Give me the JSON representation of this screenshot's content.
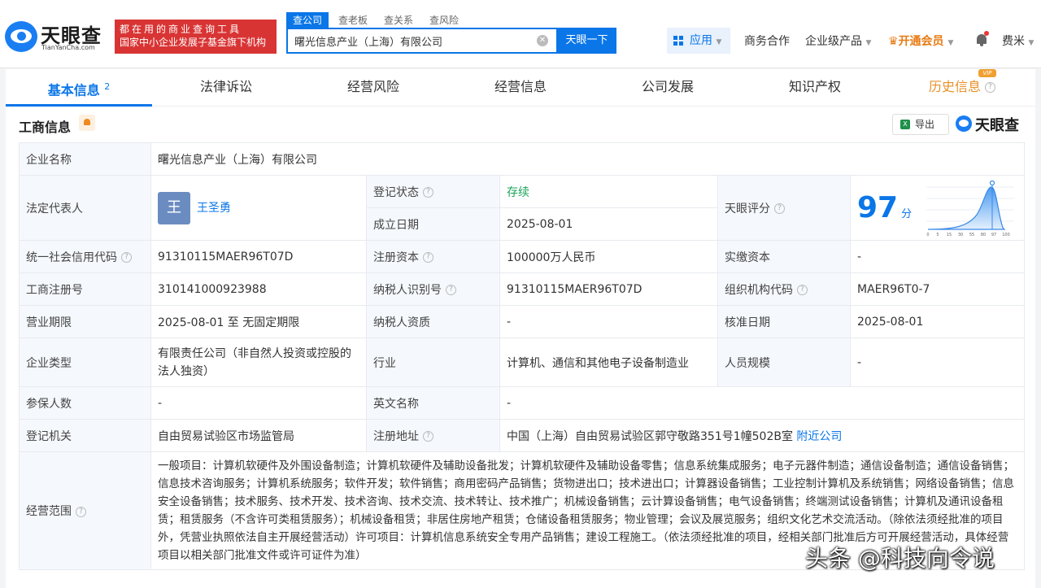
{
  "header": {
    "logo_text": "天眼查",
    "logo_sub": "TianYanCha.com",
    "slogan_line1": "都在用的商业查询工具",
    "slogan_line2": "国家中小企业发展子基金旗下机构",
    "search_tabs": [
      "查公司",
      "查老板",
      "查关系",
      "查风险"
    ],
    "search_value": "曙光信息产业（上海）有限公司",
    "search_button": "天眼一下",
    "app_label": "应用",
    "nav": {
      "business": "商务合作",
      "enterprise": "企业级产品",
      "vip": "开通会员",
      "user": "费米"
    }
  },
  "tabs": [
    {
      "label": "基本信息",
      "count": "2"
    },
    {
      "label": "法律诉讼"
    },
    {
      "label": "经营风险"
    },
    {
      "label": "经营信息"
    },
    {
      "label": "公司发展"
    },
    {
      "label": "知识产权"
    },
    {
      "label": "历史信息",
      "tag": "VIP"
    }
  ],
  "section": {
    "title": "工商信息",
    "export": "导出",
    "export_icon": "xls-icon",
    "brand": "天眼查"
  },
  "info": {
    "company_name_label": "企业名称",
    "company_name": "曙光信息产业（上海）有限公司",
    "legal_rep_label": "法定代表人",
    "legal_rep_avatar": "王",
    "legal_rep": "王圣勇",
    "reg_status_label": "登记状态",
    "reg_status": "存续",
    "found_date_label": "成立日期",
    "found_date": "2025-08-01",
    "score_label": "天眼评分",
    "score": "97",
    "score_unit": "分",
    "score_axis": [
      "0",
      "5",
      "15",
      "30",
      "55",
      "80",
      "97",
      "100"
    ],
    "credit_code_label": "统一社会信用代码",
    "credit_code": "91310115MAER96T07D",
    "reg_capital_label": "注册资本",
    "reg_capital": "100000万人民币",
    "paid_capital_label": "实缴资本",
    "paid_capital": "-",
    "reg_no_label": "工商注册号",
    "reg_no": "310141000923988",
    "taxpayer_id_label": "纳税人识别号",
    "taxpayer_id": "91310115MAER96T07D",
    "org_code_label": "组织机构代码",
    "org_code": "MAER96T0-7",
    "term_label": "营业期限",
    "term": "2025-08-01 至 无固定期限",
    "taxpayer_qual_label": "纳税人资质",
    "taxpayer_qual": "-",
    "approve_date_label": "核准日期",
    "approve_date": "2025-08-01",
    "type_label": "企业类型",
    "type": "有限责任公司（非自然人投资或控股的法人独资）",
    "industry_label": "行业",
    "industry": "计算机、通信和其他电子设备制造业",
    "staff_label": "人员规模",
    "staff": "-",
    "insured_label": "参保人数",
    "insured": "-",
    "en_name_label": "英文名称",
    "en_name": "-",
    "authority_label": "登记机关",
    "authority": "自由贸易试验区市场监管局",
    "address_label": "注册地址",
    "address": "中国（上海）自由贸易试验区郭守敬路351号1幢502B室",
    "nearby": "附近公司",
    "scope_label": "经营范围",
    "scope": "一般项目：计算机软硬件及外围设备制造；计算机软硬件及辅助设备批发；计算机软硬件及辅助设备零售；信息系统集成服务；电子元器件制造；通信设备制造；通信设备销售；信息技术咨询服务；计算机系统服务；软件开发；软件销售；商用密码产品销售；货物进出口；技术进出口；计算器设备销售；工业控制计算机及系统销售；网络设备销售；信息安全设备销售；技术服务、技术开发、技术咨询、技术交流、技术转让、技术推广；机械设备销售；云计算设备销售；电气设备销售；终端测试设备销售；计算机及通讯设备租赁；租赁服务（不含许可类租赁服务）；机械设备租赁；非居住房地产租赁；仓储设备租赁服务；物业管理；会议及展览服务；组织文化艺术交流活动。（除依法须经批准的项目外，凭营业执照依法自主开展经营活动）许可项目：计算机信息系统安全专用产品销售；建设工程施工。（依法须经批准的项目，经相关部门批准后方可开展经营活动，具体经营项目以相关部门批准文件或许可证件为准）"
  },
  "watermark": "头条 @科技向令说"
}
